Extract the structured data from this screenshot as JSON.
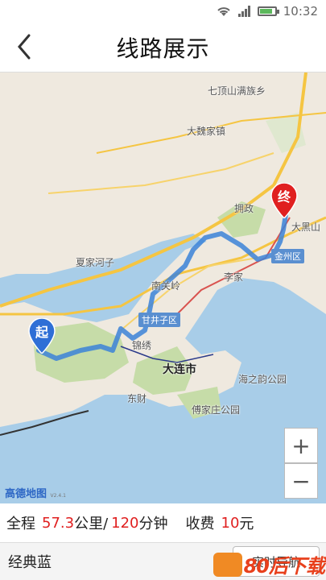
{
  "status": {
    "time": "10:32",
    "signal": "signal-icon",
    "wifi": "wifi-icon",
    "battery_level": 0.85
  },
  "header": {
    "title": "线路展示",
    "back_icon": "chevron-left-icon"
  },
  "map": {
    "labels": {
      "qidingshan": "七顶山满族乡",
      "daweijia": "大魏家镇",
      "yongzheng": "拥政",
      "daheishan": "大黑山",
      "jinzhou": "金州区",
      "xiajiahezi": "夏家河子",
      "nanguanling": "南关岭",
      "lijia": "李家",
      "ganjingzi": "甘井子区",
      "jinxiu": "锦绣",
      "dalian": "大连市",
      "haizhiyun": "海之韵公园",
      "dongcai": "东财",
      "fujiazhuang": "傅家庄公园"
    },
    "start_label": "起",
    "end_label": "终",
    "zoom_in": "+",
    "zoom_out": "−",
    "logo": "高德地图",
    "logo_version": "V2.4.1"
  },
  "summary": {
    "prefix": "全程",
    "distance": "57.3",
    "distance_unit": "公里/",
    "duration": "120",
    "duration_unit": "分钟",
    "fee_label": "收费",
    "fee": "10",
    "fee_unit": "元"
  },
  "bottom": {
    "style_name": "经典蓝",
    "nav_button": "实时导航"
  },
  "watermark": {
    "text": "80后下载"
  },
  "colors": {
    "route": "#3b82d8",
    "end_pin": "#e02020",
    "start_pin": "#2f6fd6",
    "water": "#a8cde8",
    "land": "#efe9df",
    "park": "#c6dca8"
  }
}
